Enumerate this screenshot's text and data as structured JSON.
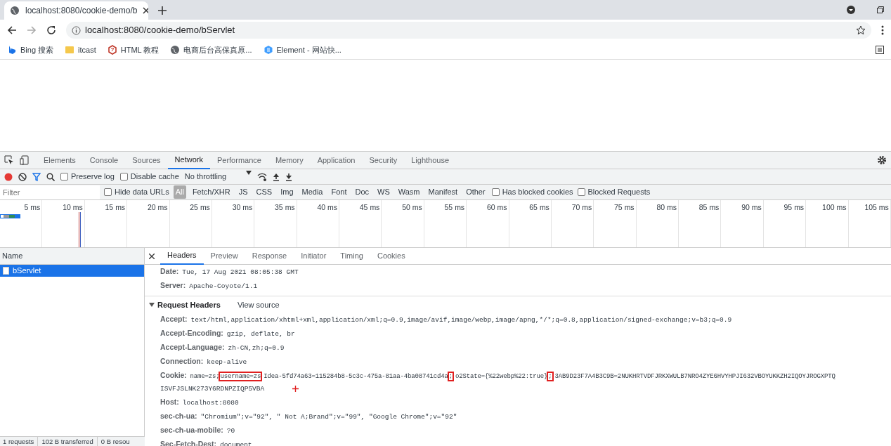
{
  "browser": {
    "tab_title": "localhost:8080/cookie-demo/b",
    "address": "localhost:8080/cookie-demo/bServlet",
    "bookmarks": [
      {
        "label": "Bing 搜索",
        "kind": "bing"
      },
      {
        "label": "itcast",
        "kind": "folder"
      },
      {
        "label": "HTML 教程",
        "kind": "html"
      },
      {
        "label": "电商后台高保真原...",
        "kind": "globe"
      },
      {
        "label": "Element - 网站快...",
        "kind": "element"
      }
    ]
  },
  "devtools": {
    "panels": [
      {
        "label": "Elements",
        "selected": false
      },
      {
        "label": "Console",
        "selected": false
      },
      {
        "label": "Sources",
        "selected": false
      },
      {
        "label": "Network",
        "selected": true
      },
      {
        "label": "Performance",
        "selected": false
      },
      {
        "label": "Memory",
        "selected": false
      },
      {
        "label": "Application",
        "selected": false
      },
      {
        "label": "Security",
        "selected": false
      },
      {
        "label": "Lighthouse",
        "selected": false
      }
    ],
    "toolbar": {
      "recording": true,
      "preserve_log": {
        "label": "Preserve log",
        "checked": false
      },
      "disable_cache": {
        "label": "Disable cache",
        "checked": false
      },
      "throttling": "No throttling"
    },
    "filter": {
      "placeholder": "Filter",
      "hide_data_urls": {
        "label": "Hide data URLs",
        "checked": false
      },
      "types": [
        {
          "label": "All",
          "selected": true
        },
        {
          "label": "Fetch/XHR",
          "selected": false
        },
        {
          "label": "JS",
          "selected": false
        },
        {
          "label": "CSS",
          "selected": false
        },
        {
          "label": "Img",
          "selected": false
        },
        {
          "label": "Media",
          "selected": false
        },
        {
          "label": "Font",
          "selected": false
        },
        {
          "label": "Doc",
          "selected": false
        },
        {
          "label": "WS",
          "selected": false
        },
        {
          "label": "Wasm",
          "selected": false
        },
        {
          "label": "Manifest",
          "selected": false
        },
        {
          "label": "Other",
          "selected": false
        }
      ],
      "has_blocked_cookies": {
        "label": "Has blocked cookies",
        "checked": false
      },
      "blocked_requests": {
        "label": "Blocked Requests",
        "checked": false
      }
    },
    "timeline_ticks": [
      "5 ms",
      "10 ms",
      "15 ms",
      "20 ms",
      "25 ms",
      "30 ms",
      "35 ms",
      "40 ms",
      "45 ms",
      "50 ms",
      "55 ms",
      "60 ms",
      "65 ms",
      "70 ms",
      "75 ms",
      "80 ms",
      "85 ms",
      "90 ms",
      "95 ms",
      "100 ms",
      "105 ms"
    ],
    "requests": {
      "column": "Name",
      "rows": [
        {
          "name": "bServlet",
          "selected": true
        }
      ]
    },
    "detail_tabs": [
      {
        "label": "Headers",
        "selected": true
      },
      {
        "label": "Preview",
        "selected": false
      },
      {
        "label": "Response",
        "selected": false
      },
      {
        "label": "Initiator",
        "selected": false
      },
      {
        "label": "Timing",
        "selected": false
      },
      {
        "label": "Cookies",
        "selected": false
      }
    ],
    "response_headers": [
      {
        "name": "Date:",
        "value": "Tue, 17 Aug 2021 08:05:38 GMT"
      },
      {
        "name": "Server:",
        "value": "Apache-Coyote/1.1"
      }
    ],
    "request_headers": {
      "title": "Request Headers",
      "expanded": true,
      "view_source": "View source",
      "rows": [
        {
          "name": "Accept:",
          "segments": [
            {
              "text": "text/html,application/xhtml+xml,application/xml;q=0.9,image/avif,image/webp,image/apng,*/*;q=0.8,application/signed-exchange;v=b3;q=0.9",
              "marked": false
            }
          ]
        },
        {
          "name": "Accept-Encoding:",
          "segments": [
            {
              "text": "gzip, deflate, br",
              "marked": false
            }
          ]
        },
        {
          "name": "Accept-Language:",
          "segments": [
            {
              "text": "zh-CN,zh;q=0.9",
              "marked": false
            }
          ]
        },
        {
          "name": "Connection:",
          "segments": [
            {
              "text": "keep-alive",
              "marked": false
            }
          ]
        },
        {
          "name": "Cookie:",
          "segments": [
            {
              "text": "name=zs;",
              "marked": false
            },
            {
              "text": "username=zs",
              "marked": true
            },
            {
              "text": "Idea-5fd74a63=115284b8-5c3c-475a-81aa-4ba08741cd4a",
              "marked": false
            },
            {
              "text": ";",
              "marked": true
            },
            {
              "text": "o2State={%22webp%22:true}",
              "marked": false
            },
            {
              "text": ";",
              "marked": true
            },
            {
              "text": "3AB9D23F7A4B3C9B=2NUKHRTVDFJRKXWULB7NRO4ZYE6HVYHPJI632VBOYUKKZH2IQOYJROGXPTQ",
              "marked": false
            }
          ],
          "continuation": "ISVFJSLNK273Y6RDNPZIQP5VBA"
        },
        {
          "name": "Host:",
          "segments": [
            {
              "text": "localhost:8080",
              "marked": false
            }
          ]
        },
        {
          "name": "sec-ch-ua:",
          "segments": [
            {
              "text": "\"Chromium\";v=\"92\", \" Not A;Brand\";v=\"99\", \"Google Chrome\";v=\"92\"",
              "marked": false
            }
          ]
        },
        {
          "name": "sec-ch-ua-mobile:",
          "segments": [
            {
              "text": "?0",
              "marked": false
            }
          ]
        },
        {
          "name": "Sec-Fetch-Dest:",
          "segments": [
            {
              "text": "document",
              "marked": false
            }
          ]
        }
      ]
    },
    "status_bar": [
      "1 requests",
      "102 B transferred",
      "0 B resou"
    ]
  }
}
